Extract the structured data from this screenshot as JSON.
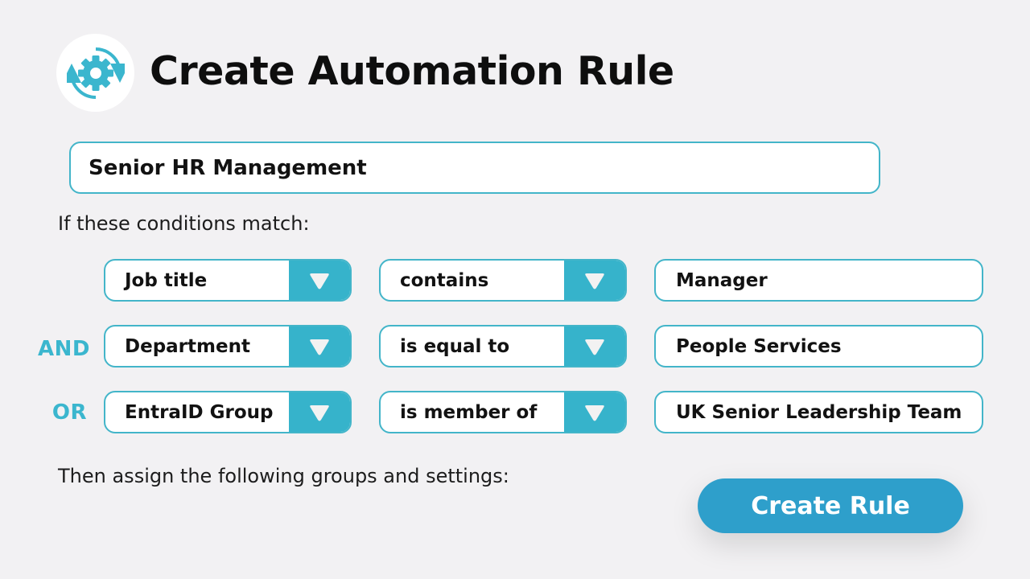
{
  "header": {
    "title": "Create Automation Rule",
    "icon": "gear-sync-icon"
  },
  "rule": {
    "name": "Senior HR Management"
  },
  "conditions_label": "If these conditions match:",
  "conditions": [
    {
      "logic": "",
      "field": "Job title",
      "operator": "contains",
      "value": "Manager"
    },
    {
      "logic": "AND",
      "field": "Department",
      "operator": "is equal to",
      "value": "People Services"
    },
    {
      "logic": "OR",
      "field": "EntraID Group",
      "operator": "is member of",
      "value": "UK Senior Leadership Team"
    }
  ],
  "assign_label": "Then assign the following groups and settings:",
  "actions": {
    "create_label": "Create Rule"
  },
  "colors": {
    "accent": "#36b3cb",
    "button": "#2e9fcb",
    "background": "#f2f1f3"
  }
}
